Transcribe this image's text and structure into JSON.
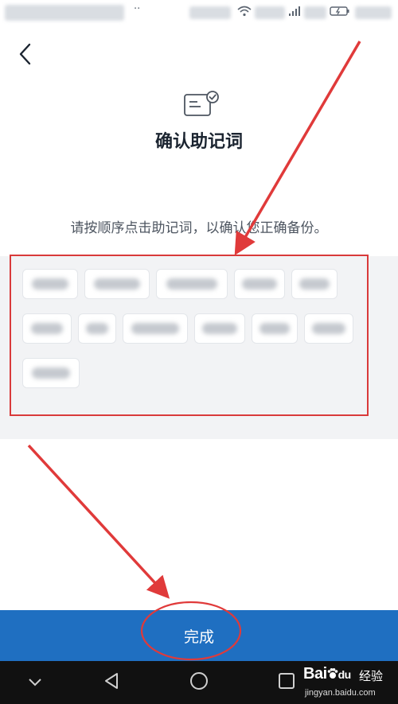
{
  "header": {
    "back_icon": "chevron-left-icon",
    "title_icon": "certificate-check-icon",
    "title": "确认助记词"
  },
  "instruction": "请按顺序点击助记词，以确认您正确备份。",
  "mnemonic_words": {
    "count": 12,
    "state": "blurred"
  },
  "done_button": {
    "label": "完成"
  },
  "nav_bar": {
    "keys": [
      "chevron-down-icon",
      "back-triangle-icon",
      "home-circle-icon",
      "recent-square-icon"
    ]
  },
  "watermark": {
    "logo": "Bai",
    "logo_suffix": "du",
    "label": "经验",
    "url": "jingyan.baidu.com"
  },
  "colors": {
    "accent": "#1f6fc1",
    "highlight": "#d93a3a",
    "background": "#ffffff",
    "words_area": "#f2f3f5"
  }
}
